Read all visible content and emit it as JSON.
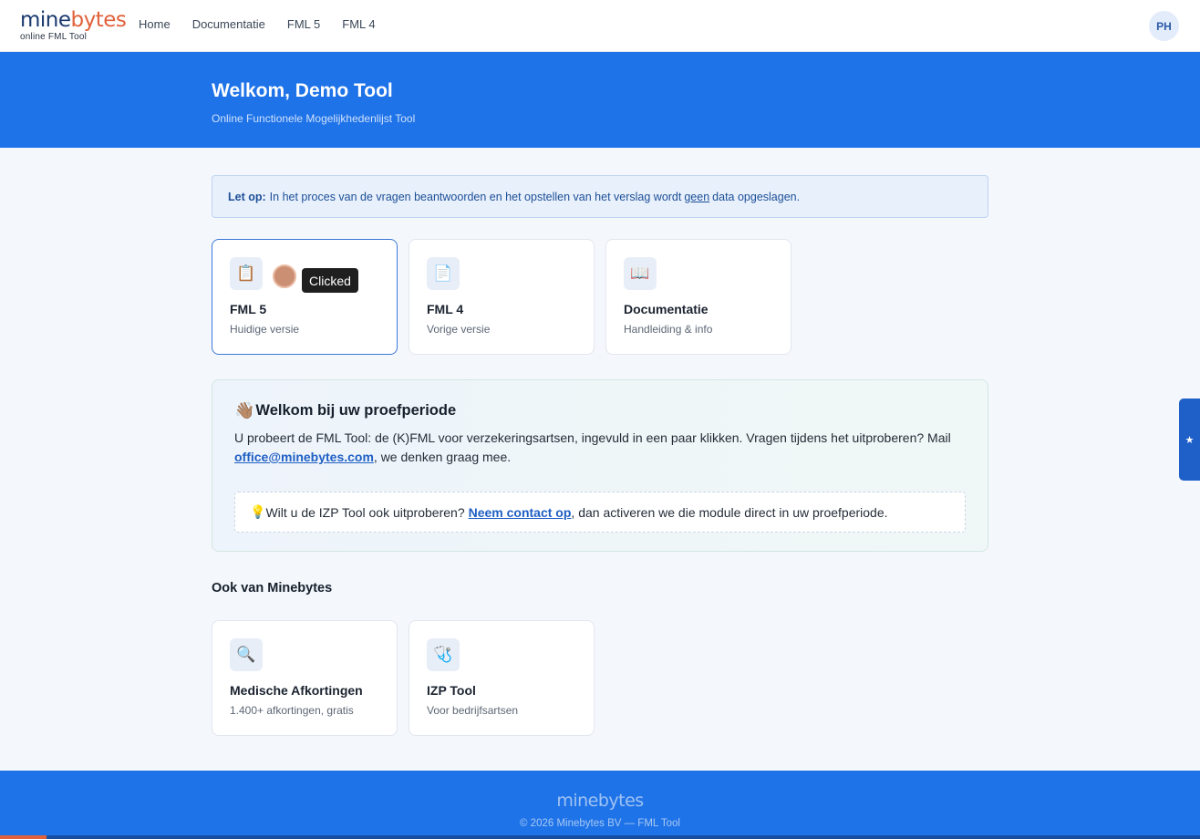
{
  "brand": {
    "name_part1": "mine",
    "name_part2": "bytes",
    "tagline": "online FML Tool",
    "primary_color": "#1e73e8",
    "accent_color": "#e0623b"
  },
  "nav": {
    "items": [
      {
        "label": "Home"
      },
      {
        "label": "Documentatie"
      },
      {
        "label": "FML 5"
      },
      {
        "label": "FML 4"
      }
    ],
    "avatar_initials": "PH"
  },
  "hero": {
    "title": "Welkom, Demo Tool",
    "subtitle": "Online Functionele Mogelijkhedenlijst Tool"
  },
  "notice": {
    "label": "Let op:",
    "text_before": "In het proces van de vragen beantwoorden en het opstellen van het verslag wordt",
    "emphasis": "geen",
    "text_after": "data opgeslagen."
  },
  "tool_cards": [
    {
      "icon": "clipboard-icon",
      "glyph": "📋",
      "title": "FML 5",
      "subtitle": "Huidige versie",
      "active": true
    },
    {
      "icon": "document-icon",
      "glyph": "📄",
      "title": "FML 4",
      "subtitle": "Vorige versie",
      "active": false
    },
    {
      "icon": "book-icon",
      "glyph": "📖",
      "title": "Documentatie",
      "subtitle": "Handleiding & info",
      "active": false
    }
  ],
  "click_indicator": {
    "tooltip": "Clicked"
  },
  "trial": {
    "wave_glyph": "👋🏽",
    "title": "Welkom bij uw proefperiode",
    "text_before": "U probeert de FML Tool: de (K)FML voor verzekeringsartsen, ingevuld in een paar klikken. Vragen tijdens het uitproberen? Mail",
    "email": "office@minebytes.com",
    "text_after": ", we denken graag mee.",
    "tip_glyph": "💡",
    "tip_before": "Wilt u de IZP Tool ook uitproberen?",
    "tip_link": "Neem contact op",
    "tip_after": ", dan activeren we die module direct in uw proefperiode."
  },
  "also": {
    "title": "Ook van Minebytes",
    "cards": [
      {
        "icon": "magnifier-icon",
        "glyph": "🔍",
        "title": "Medische Afkortingen",
        "subtitle": "1.400+ afkortingen, gratis"
      },
      {
        "icon": "stethoscope-icon",
        "glyph": "🩺",
        "title": "IZP Tool",
        "subtitle": "Voor bedrijfsartsen"
      }
    ]
  },
  "footer": {
    "logo": "minebytes",
    "copyright": "© 2026 Minebytes BV — FML Tool"
  },
  "side_tab": {
    "glyph": "★"
  }
}
